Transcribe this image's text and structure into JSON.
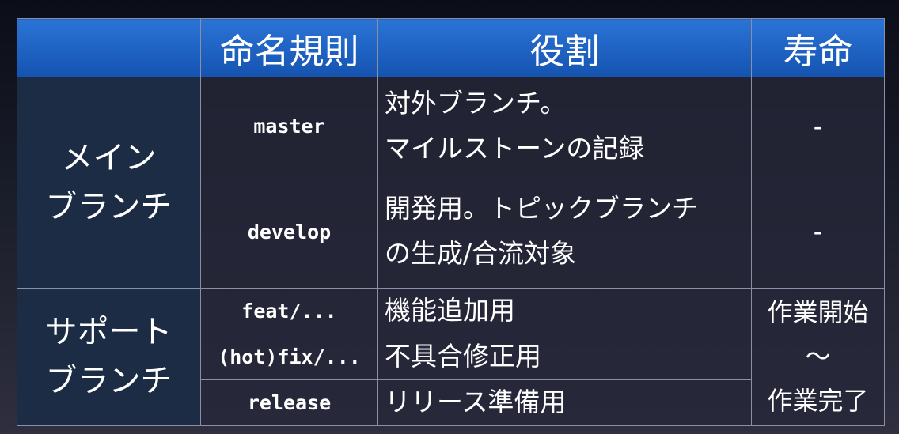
{
  "headers": {
    "group": "",
    "naming": "命名規則",
    "role": "役割",
    "lifetime": "寿命"
  },
  "main_branch": {
    "group_line1": "メイン",
    "group_line2": "ブランチ",
    "rows": [
      {
        "name": "master",
        "role_line1": "対外ブランチ。",
        "role_line2": "マイルストーンの記録",
        "lifetime": "-"
      },
      {
        "name": "develop",
        "role_line1": "開発用。トピックブランチ",
        "role_line2": "の生成/合流対象",
        "lifetime": "-"
      }
    ]
  },
  "support_branch": {
    "group_line1": "サポート",
    "group_line2": "ブランチ",
    "rows": [
      {
        "name": "feat/...",
        "role": "機能追加用"
      },
      {
        "name": "(hot)fix/...",
        "role": "不具合修正用"
      },
      {
        "name": "release",
        "role": "リリース準備用"
      }
    ],
    "lifetime_line1": "作業開始",
    "lifetime_line2": "〜",
    "lifetime_line3": "作業完了"
  },
  "colors": {
    "header_blue": "#1e63c4",
    "group_cell": "#1b2c44",
    "cell_border": "#8a8fa6"
  }
}
